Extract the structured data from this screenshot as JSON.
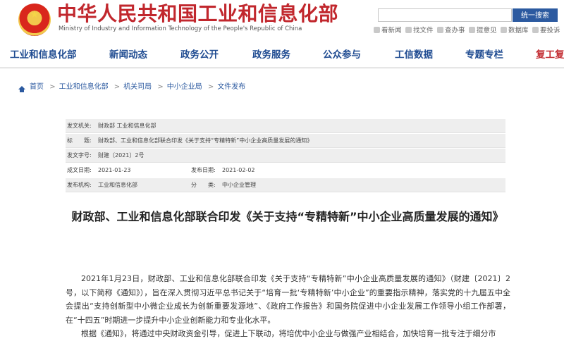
{
  "header": {
    "title": "中华人民共和国工业和信息化部",
    "subtitle": "Ministry of Industry and Information Technology of the People's Republic of China",
    "search_placeholder": "",
    "search_button": "统一搜索",
    "quick_links": [
      "看新闻",
      "找文件",
      "查办事",
      "提意见",
      "数据库",
      "要投诉"
    ]
  },
  "nav": {
    "items": [
      "工业和信息化部",
      "新闻动态",
      "政务公开",
      "政务服务",
      "公众参与",
      "工信数据",
      "专题专栏",
      "复工复"
    ]
  },
  "breadcrumb": [
    "首页",
    "工业和信息化部",
    "机关司局",
    "中小企业局",
    "文件发布"
  ],
  "meta": {
    "issuer_label": "发文机关:",
    "issuer_value": "财政部 工业和信息化部",
    "title_label": "标　　题:",
    "title_value": "财政部、工业和信息化部联合印发《关于支持“专精特新”中小企业高质量发展的通知》",
    "doc_no_label": "发文字号:",
    "doc_no_value": "财建〔2021〕2号",
    "created_label": "成文日期:",
    "created_value": "2021-01-23",
    "published_label": "发布日期:",
    "published_value": "2021-02-02",
    "publisher_label": "发布机构:",
    "publisher_value": "工业和信息化部",
    "category_label": "分　　类:",
    "category_value": "中小企业管理"
  },
  "article": {
    "title": "财政部、工业和信息化部联合印发《关于支持“专精特新”中小企业高质量发展的通知》",
    "paragraphs": [
      "2021年1月23日，财政部、工业和信息化部联合印发《关于支持“专精特新”中小企业高质量发展的通知》（财建〔2021〕2号，以下简称《通知》），旨在深入贯彻习近平总书记关于“培育一批‘专精特新’中小企业”的重要指示精神，落实党的十九届五中全会提出“支持创新型中小微企业成长为创新重要发源地”、《政府工作报告》和国务院促进中小企业发展工作领导小组工作部署，在“十四五”时期进一步提升中小企业创新能力和专业化水平。",
      "根据《通知》，将通过中央财政资金引导，促进上下联动，将培优中小企业与做强产业相结合，加快培育一批专注于细分市"
    ]
  },
  "colors": {
    "brand_red": "#c1272d",
    "nav_blue": "#1f4b91",
    "link_blue": "#2c5aa0"
  }
}
